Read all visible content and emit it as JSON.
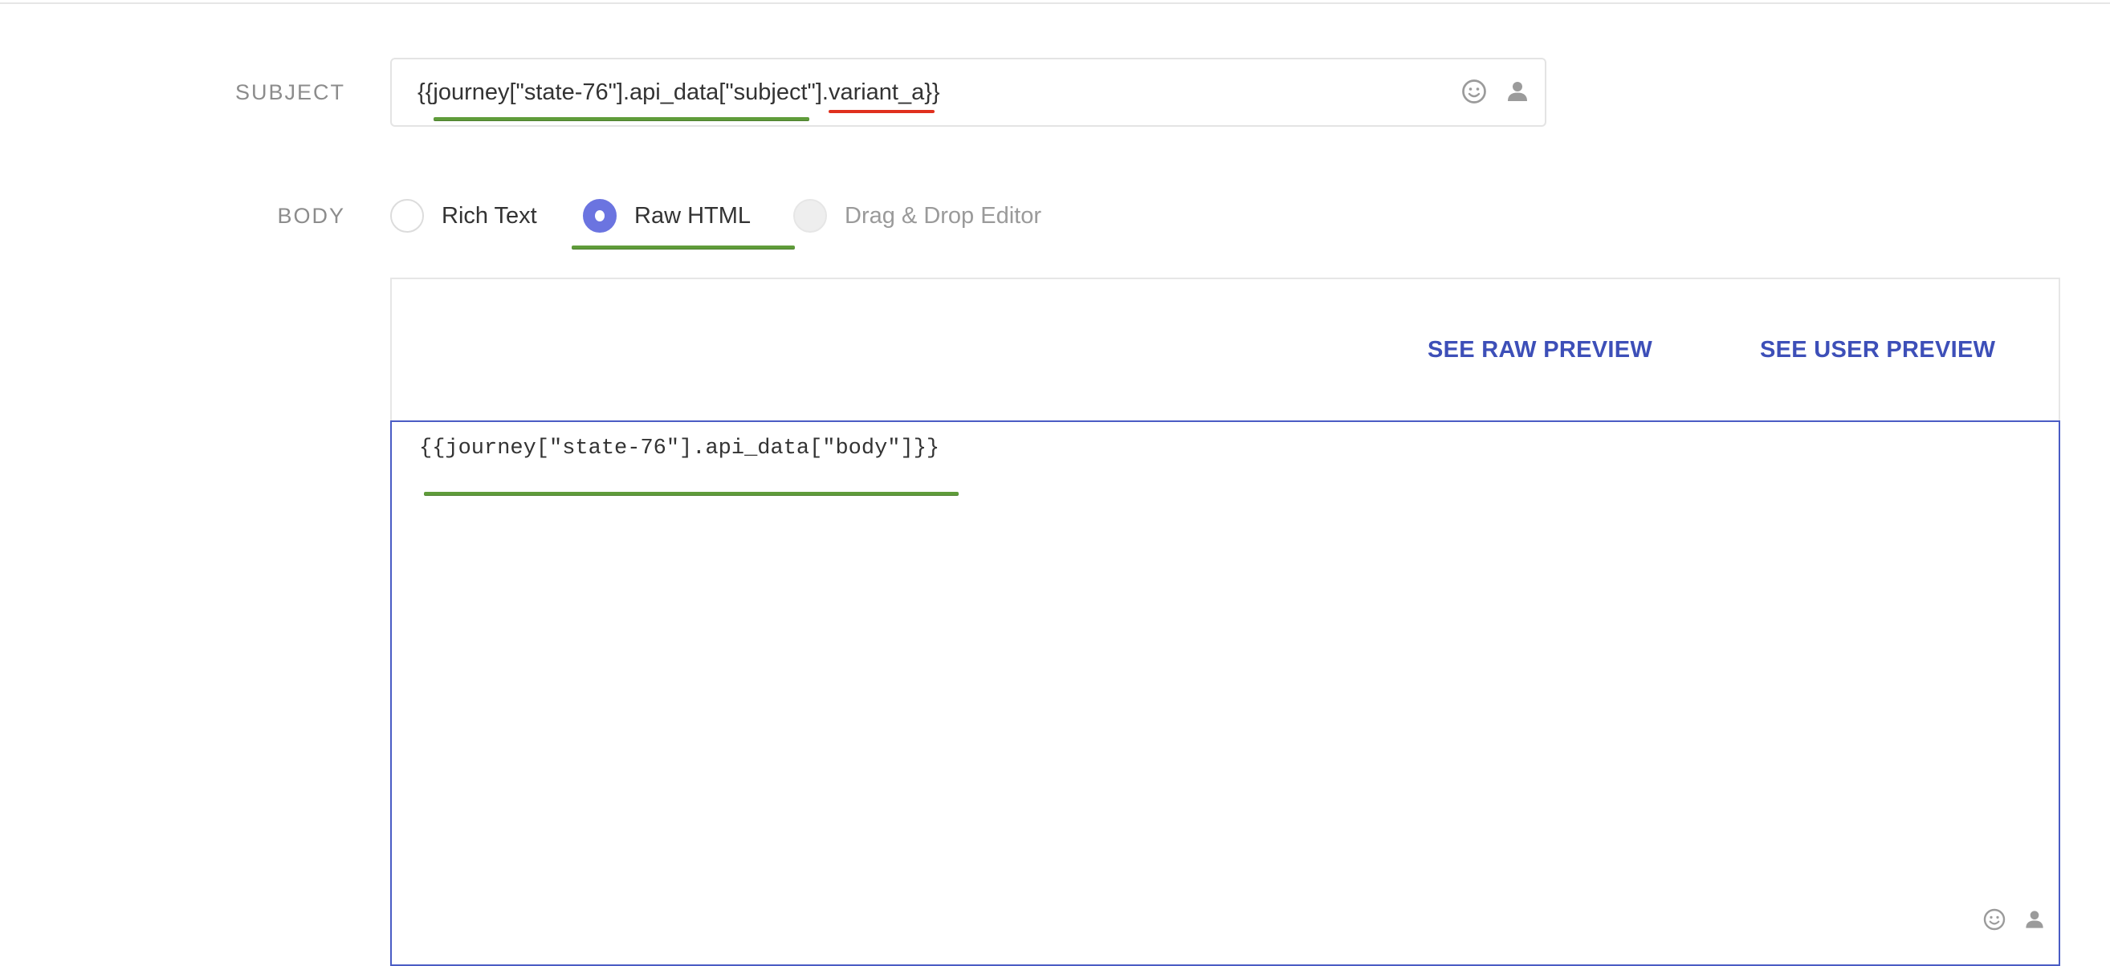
{
  "subject": {
    "label": "SUBJECT",
    "value": "{{journey[\"state-76\"].api_data[\"subject\"].variant_a}}"
  },
  "body": {
    "label": "BODY",
    "options": [
      {
        "label": "Rich Text",
        "state": "unchecked"
      },
      {
        "label": "Raw HTML",
        "state": "checked"
      },
      {
        "label": "Drag & Drop Editor",
        "state": "disabled"
      }
    ],
    "selected": "Raw HTML"
  },
  "editor": {
    "raw_preview_label": "SEE RAW PREVIEW",
    "user_preview_label": "SEE USER PREVIEW",
    "content": "{{journey[\"state-76\"].api_data[\"body\"]}}"
  },
  "icons": {
    "subject_emoji": "emoji-icon",
    "subject_person": "person-icon",
    "body_emoji": "emoji-icon",
    "body_person": "person-icon"
  },
  "annotations": {
    "ok_color": "#5f9c3a",
    "error_color": "#e0301e"
  },
  "colors": {
    "accent": "#6b74e0",
    "link": "#3d4fb8",
    "focus_border": "#4a5cc4"
  }
}
